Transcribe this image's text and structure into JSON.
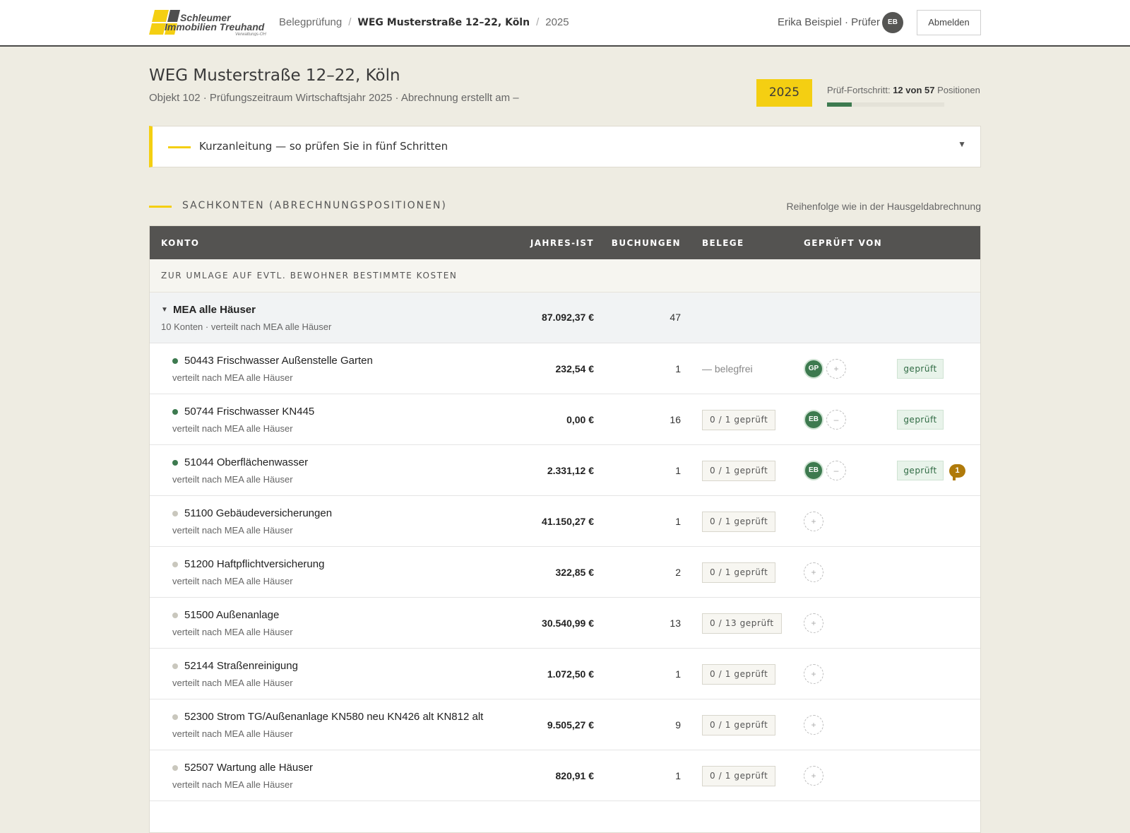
{
  "header": {
    "logo": {
      "line1": "Schleumer",
      "line2": "Immobilien Treuhand",
      "line3": "Verwaltungs-OHG"
    },
    "breadcrumb": [
      "Belegprüfung",
      "WEG Musterstraße 12–22, Köln",
      "2025"
    ],
    "user_label": "Erika Beispiel · Prüfer",
    "user_initials": "EB",
    "logout_label": "Abmelden"
  },
  "page": {
    "title": "WEG Musterstraße 12–22, Köln",
    "subtitle": "Objekt 102 · Prüfungszeitraum Wirtschaftsjahr 2025 · Abrechnung erstellt am –",
    "year": "2025",
    "progress": {
      "prefix": "Prüf-Fortschritt:",
      "done": "12 von 57",
      "suffix": "Positionen",
      "fraction": 0.21
    }
  },
  "guide": {
    "label": "Kurzanleitung — so prüfen Sie in fünf Schritten",
    "chevron_icon": "chevron-down-icon"
  },
  "section": {
    "title": "SACHKONTEN (ABRECHNUNGSPOSITIONEN)",
    "note": "Reihenfolge wie in der Hausgeldabrechnung"
  },
  "table": {
    "columns": [
      "KONTO",
      "JAHRES-IST",
      "BUCHUNGEN",
      "BELEGE",
      "GEPRÜFT VON"
    ],
    "group_label": "ZUR UMLAGE AUF EVTL. BEWOHNER BESTIMMTE KOSTEN",
    "group": {
      "name": "MEA alle Häuser",
      "sub": "10 Konten · verteilt nach MEA alle Häuser",
      "amount": "87.092,37 €",
      "count": "47"
    },
    "colors": {
      "dot_done": "#3d7a4f",
      "dot_open": "#c9c7bd"
    },
    "rows": [
      {
        "name": "50443 Frischwasser Außenstelle Garten",
        "sub": "verteilt nach MEA alle Häuser",
        "amount": "232,54 €",
        "count": "1",
        "beleg_free": "— belegfrei",
        "beleg": "",
        "reviewer": "GP",
        "second": "+",
        "status": "geprüft",
        "comments": "",
        "done": true
      },
      {
        "name": "50744 Frischwasser KN445",
        "sub": "verteilt nach MEA alle Häuser",
        "amount": "0,00 €",
        "count": "16",
        "beleg_free": "",
        "beleg": "0 / 1 geprüft",
        "reviewer": "EB",
        "second": "–",
        "status": "geprüft",
        "comments": "",
        "done": true
      },
      {
        "name": "51044 Oberflächenwasser",
        "sub": "verteilt nach MEA alle Häuser",
        "amount": "2.331,12 €",
        "count": "1",
        "beleg_free": "",
        "beleg": "0 / 1 geprüft",
        "reviewer": "EB",
        "second": "–",
        "status": "geprüft",
        "comments": "1",
        "done": true
      },
      {
        "name": "51100 Gebäudeversicherungen",
        "sub": "verteilt nach MEA alle Häuser",
        "amount": "41.150,27 €",
        "count": "1",
        "beleg_free": "",
        "beleg": "0 / 1 geprüft",
        "reviewer": "",
        "second": "+",
        "status": "",
        "comments": "",
        "done": false
      },
      {
        "name": "51200 Haftpflichtversicherung",
        "sub": "verteilt nach MEA alle Häuser",
        "amount": "322,85 €",
        "count": "2",
        "beleg_free": "",
        "beleg": "0 / 1 geprüft",
        "reviewer": "",
        "second": "+",
        "status": "",
        "comments": "",
        "done": false
      },
      {
        "name": "51500 Außenanlage",
        "sub": "verteilt nach MEA alle Häuser",
        "amount": "30.540,99 €",
        "count": "13",
        "beleg_free": "",
        "beleg": "0 / 13 geprüft",
        "reviewer": "",
        "second": "+",
        "status": "",
        "comments": "",
        "done": false
      },
      {
        "name": "52144 Straßenreinigung",
        "sub": "verteilt nach MEA alle Häuser",
        "amount": "1.072,50 €",
        "count": "1",
        "beleg_free": "",
        "beleg": "0 / 1 geprüft",
        "reviewer": "",
        "second": "+",
        "status": "",
        "comments": "",
        "done": false
      },
      {
        "name": "52300 Strom TG/Außenanlage KN580 neu KN426 alt KN812 alt",
        "sub": "verteilt nach MEA alle Häuser",
        "amount": "9.505,27 €",
        "count": "9",
        "beleg_free": "",
        "beleg": "0 / 1 geprüft",
        "reviewer": "",
        "second": "+",
        "status": "",
        "comments": "",
        "done": false
      },
      {
        "name": "52507 Wartung alle Häuser",
        "sub": "verteilt nach MEA alle Häuser",
        "amount": "820,91 €",
        "count": "1",
        "beleg_free": "",
        "beleg": "0 / 1 geprüft",
        "reviewer": "",
        "second": "+",
        "status": "",
        "comments": "",
        "done": false
      }
    ]
  }
}
